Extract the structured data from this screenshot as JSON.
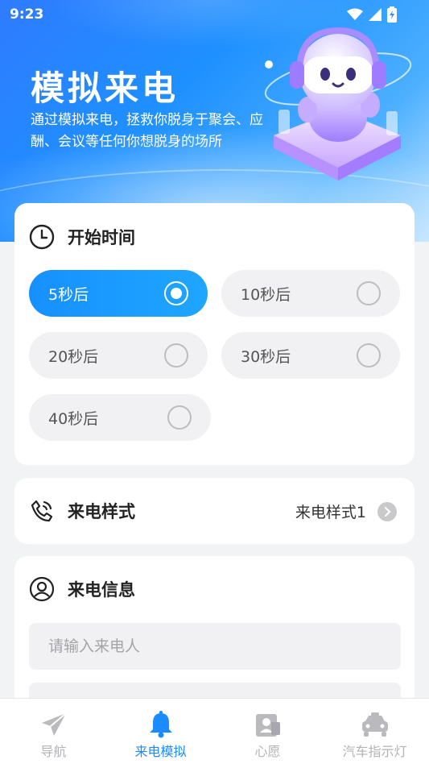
{
  "status_bar": {
    "time": "9:23"
  },
  "hero": {
    "title": "模拟来电",
    "description": "通过模拟来电，拯救你脱身于聚会、应酬、会议等任何你想脱身的场所"
  },
  "start_time": {
    "title": "开始时间",
    "options": [
      {
        "label": "5秒后",
        "selected": true
      },
      {
        "label": "10秒后",
        "selected": false
      },
      {
        "label": "20秒后",
        "selected": false
      },
      {
        "label": "30秒后",
        "selected": false
      },
      {
        "label": "40秒后",
        "selected": false
      }
    ]
  },
  "call_style": {
    "title": "来电样式",
    "value": "来电样式1"
  },
  "call_info": {
    "title": "来电信息",
    "caller_placeholder": "请输入来电人",
    "caller_value": ""
  },
  "bottom_nav": {
    "items": [
      {
        "label": "导航",
        "icon": "paper-plane-icon",
        "active": false
      },
      {
        "label": "来电模拟",
        "icon": "bell-icon",
        "active": true
      },
      {
        "label": "心愿",
        "icon": "wish-card-icon",
        "active": false
      },
      {
        "label": "汽车指示灯",
        "icon": "car-icon",
        "active": false
      }
    ]
  },
  "colors": {
    "accent": "#1a8cff",
    "hero_gradient_start": "#2f7bff",
    "hero_gradient_end": "#c6e6ff",
    "page_background": "#f2f3f5"
  }
}
